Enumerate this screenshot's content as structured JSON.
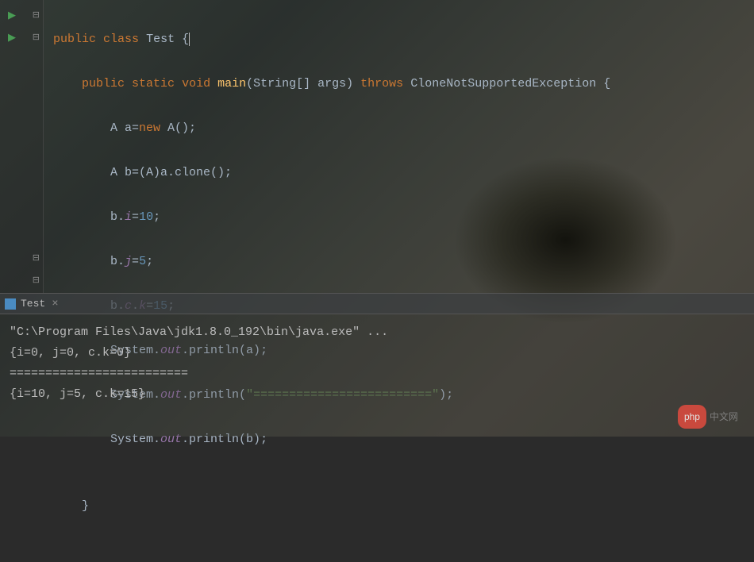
{
  "code": {
    "l1_public": "public",
    "l1_class": "class",
    "l1_name": "Test",
    "l1_brace": "{",
    "l2_public": "public",
    "l2_static": "static",
    "l2_void": "void",
    "l2_main": "main",
    "l2_params": "(String[] args)",
    "l2_throws": "throws",
    "l2_exc": "CloneNotSupportedException {",
    "l3": "A a=",
    "l3_new": "new",
    "l3_end": " A();",
    "l4": "A b=(A)a.clone();",
    "l5_a": "b.",
    "l5_i": "i",
    "l5_eq": "=",
    "l5_v": "10",
    "l5_s": ";",
    "l6_a": "b.",
    "l6_j": "j",
    "l6_eq": "=",
    "l6_v": "5",
    "l6_s": ";",
    "l7_a": "b.",
    "l7_c": "c",
    "l7_d": ".",
    "l7_k": "k",
    "l7_eq": "=",
    "l7_v": "15",
    "l7_s": ";",
    "l8_sys": "System.",
    "l8_out": "out",
    "l8_p": ".println(a);",
    "l9_sys": "System.",
    "l9_out": "out",
    "l9_p1": ".println(",
    "l9_str": "\"=========================\"",
    "l9_p2": ");",
    "l10_sys": "System.",
    "l10_out": "out",
    "l10_p": ".println(b);",
    "l12_brace": "}"
  },
  "tab": {
    "label": "Test",
    "close": "×"
  },
  "console": {
    "l1": "\"C:\\Program Files\\Java\\jdk1.8.0_192\\bin\\java.exe\" ...",
    "l2": "{i=0, j=0, c.k=0}",
    "l3": "=========================",
    "l4": "{i=10, j=5, c.k=15}"
  },
  "watermark": {
    "badge": "php",
    "text": "中文网"
  }
}
